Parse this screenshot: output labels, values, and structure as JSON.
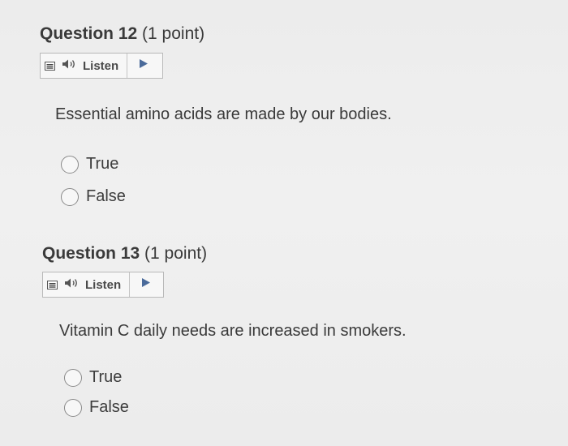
{
  "questions": [
    {
      "number": "Question 12",
      "points": "(1 point)",
      "listen_label": "Listen",
      "stem": "Essential amino acids are made by our bodies.",
      "options": [
        "True",
        "False"
      ]
    },
    {
      "number": "Question 13",
      "points": "(1 point)",
      "listen_label": "Listen",
      "stem": "Vitamin C daily needs are increased in smokers.",
      "options": [
        "True",
        "False"
      ]
    }
  ],
  "icons": {
    "menu": "menu-icon",
    "speaker": "speaker-icon",
    "play": "play-icon"
  },
  "colors": {
    "text": "#3a3a3a",
    "border": "#b9b9b9",
    "play": "#4a6a9a"
  }
}
